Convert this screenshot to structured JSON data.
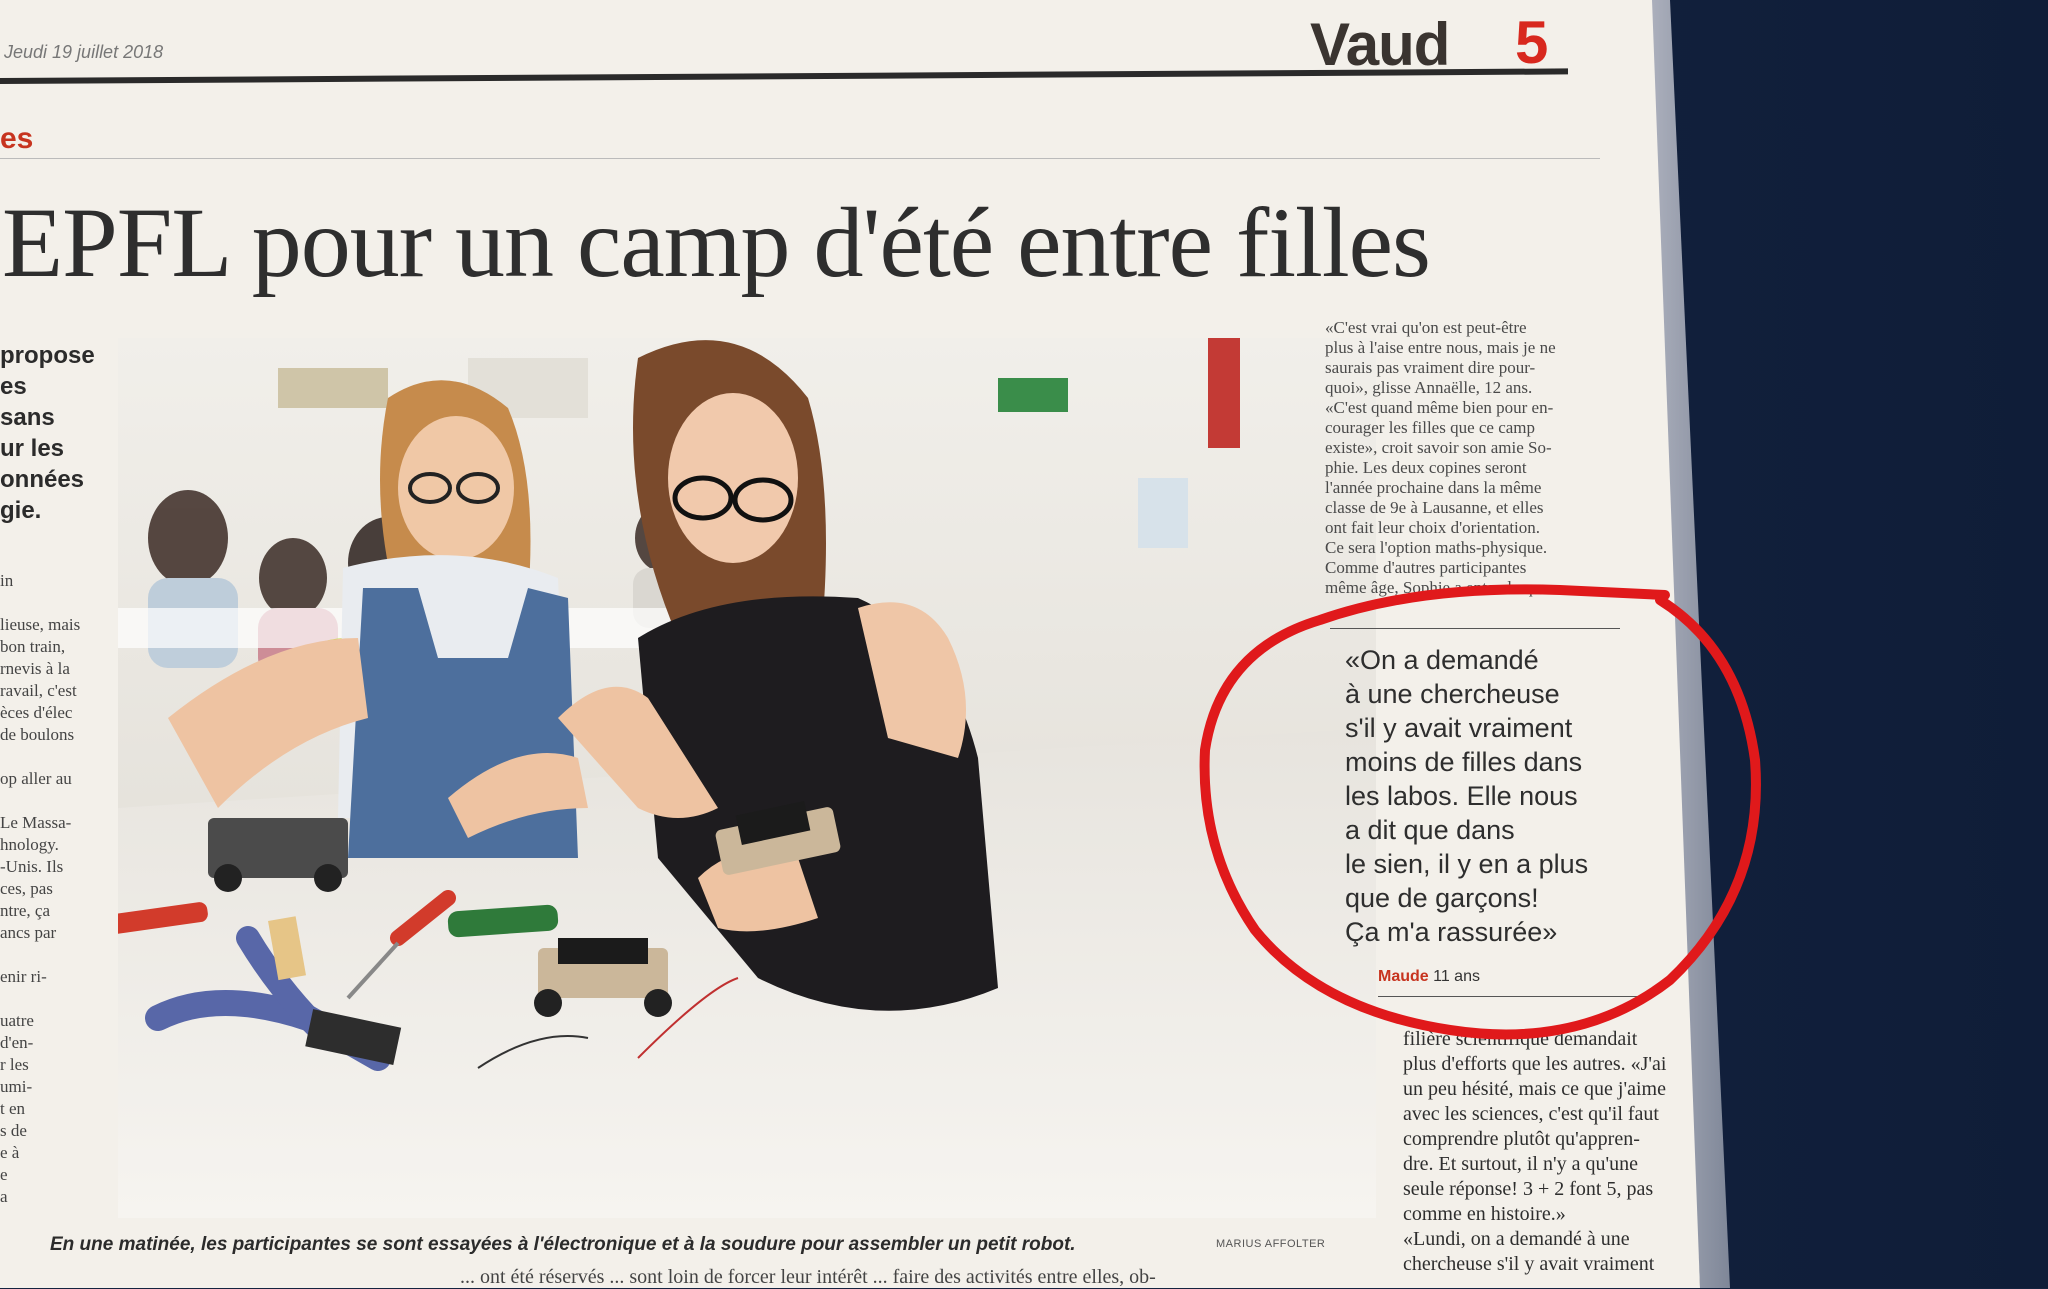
{
  "header": {
    "date": "Jeudi 19 juillet 2018",
    "section": "Vaud",
    "page_number": "5",
    "kicker": "es"
  },
  "headline": "EPFL pour un camp d'été entre filles",
  "lead_fragment": [
    "propose",
    "es",
    "sans",
    "ur les",
    "onnées",
    "gie."
  ],
  "left_column_fragments": [
    "in",
    "",
    "lieuse, mais",
    "bon train,",
    "rnevis à la",
    "ravail, c'est",
    "èces d'élec",
    "de boulons",
    "",
    "op aller au",
    "",
    "Le Massa-",
    "hnology.",
    "-Unis. Ils",
    "ces, pas",
    "ntre, ça",
    "ancs par",
    "",
    "enir ri-",
    "",
    "uatre",
    "d'en-",
    "r les",
    "umi-",
    "t en",
    "s de",
    "e à",
    "e",
    "a"
  ],
  "photo": {
    "caption": "En une matinée, les participantes se sont essayées à l'électronique et à la soudure pour assembler un petit robot.",
    "credit": "MARIUS AFFOLTER"
  },
  "right_column_top": [
    "«C'est vrai qu'on est peut-être",
    "plus à l'aise entre nous, mais je ne",
    "saurais pas vraiment dire pour-",
    "quoi», glisse Annaëlle, 12 ans.",
    "«C'est quand même bien pour en-",
    "courager les filles que ce camp",
    "existe», croit savoir son amie So-",
    "phie. Les deux copines seront",
    "l'année prochaine dans la même",
    "classe de 9e à Lausanne, et elles",
    "ont fait leur choix d'orientation.",
    "Ce sera l'option maths-physique.",
    "Comme d'autres participantes",
    "même âge, Sophie a entendu que"
  ],
  "pull_quote": {
    "lines": [
      "«On a demandé",
      "à une chercheuse",
      "s'il y avait vraiment",
      "moins de filles dans",
      "les labos. Elle nous",
      "a dit que dans",
      "le sien, il y en a plus",
      "que de garçons!",
      "Ça m'a rassurée»"
    ],
    "author": "Maude",
    "age": "11 ans"
  },
  "right_column_bottom": [
    "filière scientifique demandait",
    "plus d'efforts que les autres. «J'ai",
    "un peu hésité, mais ce que j'aime",
    "avec les sciences, c'est qu'il faut",
    "comprendre plutôt qu'appren-",
    "dre. Et surtout, il n'y a qu'une",
    "seule réponse! 3 + 2 font 5, pas",
    "comme en histoire.»",
    "«Lundi, on a demandé à une",
    "chercheuse s'il y avait vraiment"
  ],
  "bottom_fragment": "... ont été réservés ... sont loin de forcer leur intérêt ... faire des activités entre elles, ob-",
  "colors": {
    "accent_red": "#d8281e",
    "annotation_red": "#e0191b",
    "paper": "#f3f0ea",
    "background": "#14233f"
  }
}
